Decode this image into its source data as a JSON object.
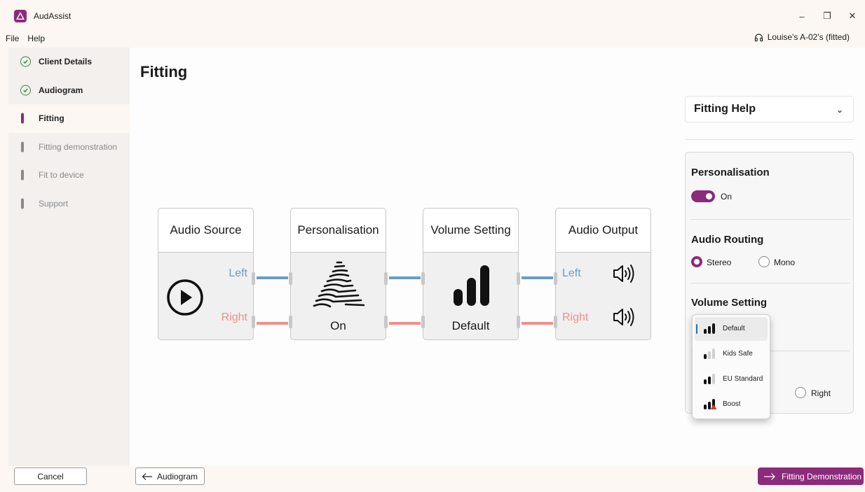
{
  "window": {
    "title": "AudAssist",
    "controls": {
      "minimize": "–",
      "restore": "❐",
      "close": "✕"
    }
  },
  "menu": {
    "items": [
      "File",
      "Help"
    ]
  },
  "device": {
    "label": "Louise's A-02's (fitted)",
    "icon": "headphones-icon"
  },
  "sidebar": {
    "items": [
      {
        "label": "Client Details",
        "state": "done"
      },
      {
        "label": "Audiogram",
        "state": "done"
      },
      {
        "label": "Fitting",
        "state": "active"
      },
      {
        "label": "Fitting demonstration",
        "state": "pending"
      },
      {
        "label": "Fit to device",
        "state": "pending"
      },
      {
        "label": "Support",
        "state": "pending"
      }
    ]
  },
  "page": {
    "title": "Fitting"
  },
  "pipeline": {
    "source": {
      "title": "Audio Source",
      "left": "Left",
      "right": "Right",
      "icon": "play-icon"
    },
    "personalisation": {
      "title": "Personalisation",
      "caption": "On",
      "icon": "personalisation-logo-icon"
    },
    "volume": {
      "title": "Volume Setting",
      "caption": "Default",
      "icon": "volume-bars-icon"
    },
    "output": {
      "title": "Audio Output",
      "left": "Left",
      "right": "Right",
      "icon": "speaker-icon"
    }
  },
  "help": {
    "label": "Fitting Help",
    "chevron": "⌄"
  },
  "settings": {
    "personalisation": {
      "title": "Personalisation",
      "toggle_label": "On",
      "toggle_on": true
    },
    "routing": {
      "title": "Audio Routing",
      "options": [
        "Stereo",
        "Mono"
      ],
      "selected": "Stereo"
    },
    "volume": {
      "title": "Volume Setting"
    },
    "hidden_section": {
      "right_option": "Right"
    }
  },
  "volume_menu": {
    "options": [
      {
        "label": "Default",
        "selected": true
      },
      {
        "label": "Kids Safe",
        "selected": false
      },
      {
        "label": "EU Standard",
        "selected": false
      },
      {
        "label": "Boost",
        "selected": false,
        "warning": true
      }
    ]
  },
  "footer": {
    "cancel": "Cancel",
    "back": "Audiogram",
    "next": "Fitting Demonstration"
  },
  "colors": {
    "accent": "#8c2a7b",
    "left_channel": "#6b9dc4",
    "right_channel": "#ef8f8a",
    "done": "#2e8b3e"
  }
}
